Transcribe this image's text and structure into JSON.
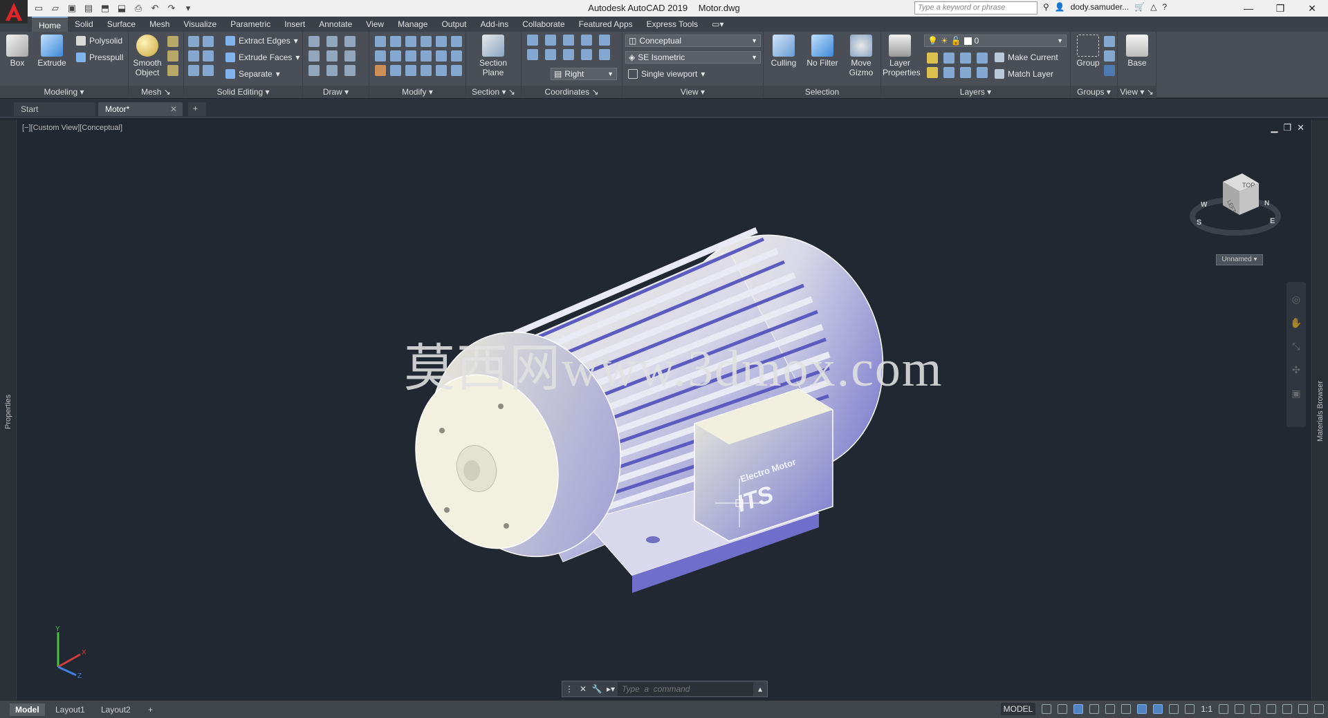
{
  "app": {
    "name": "Autodesk AutoCAD 2019",
    "file": "Motor.dwg"
  },
  "search": {
    "placeholder": "Type a keyword or phrase"
  },
  "user": {
    "name": "dody.samuder..."
  },
  "ribbon_tabs": [
    "Home",
    "Solid",
    "Surface",
    "Mesh",
    "Visualize",
    "Parametric",
    "Insert",
    "Annotate",
    "View",
    "Manage",
    "Output",
    "Add-ins",
    "Collaborate",
    "Featured Apps",
    "Express Tools"
  ],
  "ribbon": {
    "modeling": {
      "title": "Modeling",
      "box": "Box",
      "extrude": "Extrude",
      "polysolid": "Polysolid",
      "presspull": "Presspull"
    },
    "mesh": {
      "title": "Mesh",
      "smooth1": "Smooth",
      "smooth2": "Object"
    },
    "solid_editing": {
      "title": "Solid Editing",
      "extract_edges": "Extract Edges",
      "extrude_faces": "Extrude Faces",
      "separate": "Separate"
    },
    "draw": {
      "title": "Draw"
    },
    "modify": {
      "title": "Modify"
    },
    "section": {
      "title": "Section",
      "plane1": "Section",
      "plane2": "Plane"
    },
    "coordinates": {
      "title": "Coordinates",
      "ucs_value": "Right"
    },
    "view": {
      "title": "View",
      "visual_style": "Conceptual",
      "view_direction": "SE Isometric",
      "viewport": "Single viewport"
    },
    "selection": {
      "title": "Selection",
      "culling": "Culling",
      "no_filter": "No Filter",
      "move1": "Move",
      "move2": "Gizmo"
    },
    "layers": {
      "title": "Layers",
      "layer_props1": "Layer",
      "layer_props2": "Properties",
      "layer_value": "0",
      "make_current": "Make Current",
      "match_layer": "Match Layer"
    },
    "groups": {
      "title": "Groups",
      "group": "Group"
    },
    "view2": {
      "title": "View",
      "base": "Base"
    }
  },
  "doc_tabs": [
    {
      "label": "Start"
    },
    {
      "label": "Motor*"
    }
  ],
  "viewport": {
    "label": "[−][Custom View][Conceptual]",
    "viewcube_face": "TOP",
    "viewcube_side": "LEFT",
    "compass": {
      "n": "N",
      "s": "S",
      "e": "E",
      "w": "W"
    },
    "ucs_name": "Unnamed",
    "watermark": "莫西网www.3dmox.com",
    "motor_brand": "Electro Motor",
    "motor_logo": "ITS",
    "axis_x": "X",
    "axis_y": "Y",
    "axis_z": "Z"
  },
  "side_panels": {
    "left": "Properties",
    "right": "Materials Browser"
  },
  "command": {
    "placeholder": "Type  a  command"
  },
  "layout_tabs": [
    "Model",
    "Layout1",
    "Layout2"
  ],
  "status": {
    "model": "MODEL",
    "scale": "1:1"
  },
  "colors": {
    "accent": "#4f83c2",
    "motor_light": "#eeeedd",
    "motor_shade": "#6c6cc8",
    "viewport_bg": "#212832"
  }
}
